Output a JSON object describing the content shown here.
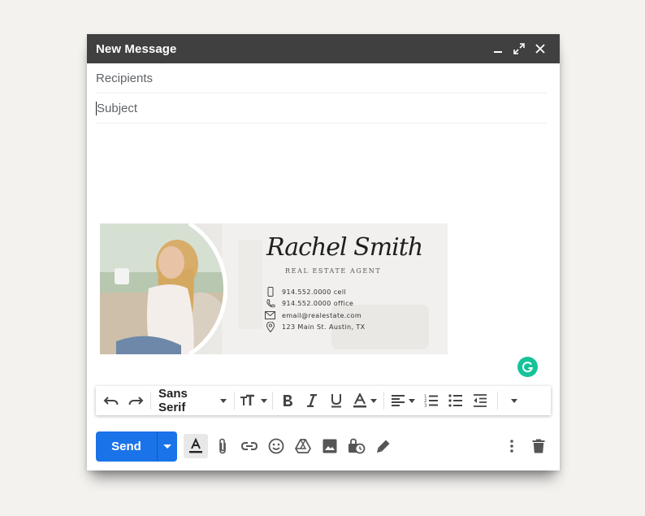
{
  "window": {
    "title": "New Message",
    "controls": [
      "minimize-icon",
      "expand-icon",
      "close-icon"
    ]
  },
  "fields": {
    "recipients_placeholder": "Recipients",
    "subject_placeholder": "Subject"
  },
  "signature": {
    "name": "Rachel Smith",
    "role": "REAL ESTATE AGENT",
    "lines": [
      {
        "icon": "mobile-phone-icon",
        "text": "914.552.0000 cell"
      },
      {
        "icon": "phone-icon",
        "text": "914.552.0000 office"
      },
      {
        "icon": "envelope-icon",
        "text": "email@realestate.com"
      },
      {
        "icon": "map-pin-icon",
        "text": "123 Main St. Austin, TX"
      }
    ]
  },
  "format_toolbar": {
    "font_family": "Sans Serif",
    "tools": [
      "undo-icon",
      "redo-icon",
      "font-size-icon",
      "bold-icon",
      "italic-icon",
      "underline-icon",
      "text-color-icon",
      "align-icon",
      "numbered-list-icon",
      "bulleted-list-icon",
      "indent-less-icon",
      "more-formatting-icon"
    ]
  },
  "bottom_toolbar": {
    "send_label": "Send",
    "tools": [
      "formatting-options-icon",
      "attach-icon",
      "link-icon",
      "emoji-icon",
      "drive-icon",
      "photo-icon",
      "confidential-mode-icon",
      "signature-icon",
      "more-options-icon",
      "trash-icon"
    ]
  },
  "colors": {
    "titlebar": "#404040",
    "send": "#1a73e8",
    "grammarly": "#15c39a",
    "page_bg": "#f3f2ef"
  }
}
